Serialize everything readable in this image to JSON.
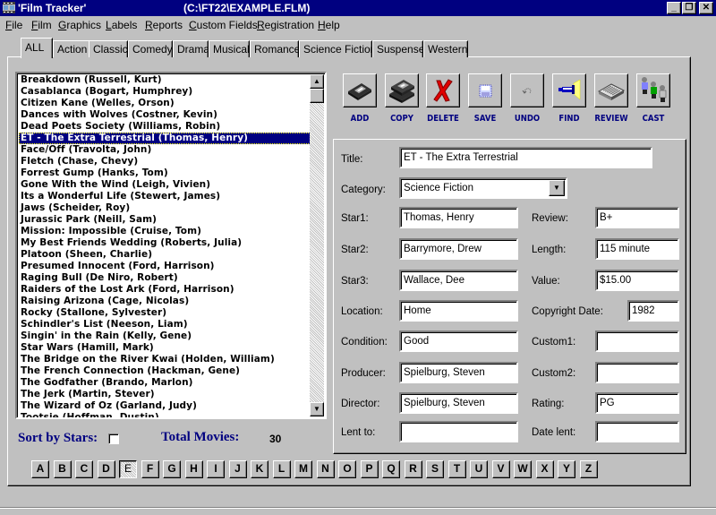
{
  "window": {
    "title": "'Film Tracker'",
    "path": "(C:\\FT22\\EXAMPLE.FLM)",
    "icons": {
      "app": "film-strip-icon",
      "minimize": "minimize-icon",
      "restore": "restore-icon",
      "close": "close-icon"
    },
    "controls": {
      "minimize": "_",
      "restore": "❐",
      "close": "✕"
    }
  },
  "menu": [
    {
      "label": "File",
      "accel": "F",
      "rest": "ile"
    },
    {
      "label": "Film",
      "accel": "F",
      "rest": "ilm"
    },
    {
      "label": "Graphics",
      "accel": "G",
      "rest": "raphics"
    },
    {
      "label": "Labels",
      "accel": "L",
      "rest": "abels"
    },
    {
      "label": "Reports",
      "accel": "R",
      "rest": "eports"
    },
    {
      "label": "Custom Fields",
      "accel": "C",
      "rest": "ustom Fields"
    },
    {
      "label": "Registration",
      "accel": "R",
      "rest": "egistration"
    },
    {
      "label": "Help",
      "accel": "H",
      "rest": "elp"
    }
  ],
  "tabs": [
    {
      "label": "ALL",
      "active": true
    },
    {
      "label": "Action"
    },
    {
      "label": "Classic"
    },
    {
      "label": "Comedy"
    },
    {
      "label": "Drama"
    },
    {
      "label": "Musical"
    },
    {
      "label": "Romance"
    },
    {
      "label": "Science Fiction"
    },
    {
      "label": "Suspense"
    },
    {
      "label": "Western"
    }
  ],
  "movies": [
    "Breakdown (Russell, Kurt)",
    "Casablanca (Bogart, Humphrey)",
    "Citizen Kane (Welles, Orson)",
    "Dances with Wolves (Costner, Kevin)",
    "Dead Poets Society (Williams, Robin)",
    "ET - The Extra Terrestrial (Thomas, Henry)",
    "Face/Off (Travolta, John)",
    "Fletch (Chase, Chevy)",
    "Forrest Gump (Hanks, Tom)",
    "Gone With the Wind (Leigh, Vivien)",
    "Its a Wonderful Life (Stewert, James)",
    "Jaws (Scheider, Roy)",
    "Jurassic Park (Neill, Sam)",
    "Mission: Impossible (Cruise, Tom)",
    "My Best Friends Wedding (Roberts, Julia)",
    "Platoon (Sheen, Charlie)",
    "Presumed Innocent (Ford, Harrison)",
    "Raging Bull (De Niro, Robert)",
    "Raiders of the Lost Ark (Ford, Harrison)",
    "Raising Arizona (Cage, Nicolas)",
    "Rocky (Stallone, Sylvester)",
    "Schindler's List (Neeson, Liam)",
    "Singin' in the Rain (Kelly, Gene)",
    "Star Wars (Hamill, Mark)",
    "The Bridge on the River Kwai (Holden, William)",
    "The French Connection (Hackman, Gene)",
    "The Godfather (Brando, Marlon)",
    "The Jerk (Martin, Stever)",
    "The Wizard of Oz (Garland, Judy)",
    "Tootsie (Hoffman, Dustin)"
  ],
  "selected_movie_index": 5,
  "scrollbar": {
    "up": "▲",
    "down": "▼"
  },
  "sort": {
    "label": "Sort by Stars:",
    "checked": false
  },
  "total": {
    "label": "Total Movies:",
    "value": "30"
  },
  "alphabet": [
    "A",
    "B",
    "C",
    "D",
    "E",
    "F",
    "G",
    "H",
    "I",
    "J",
    "K",
    "L",
    "M",
    "N",
    "O",
    "P",
    "Q",
    "R",
    "S",
    "T",
    "U",
    "V",
    "W",
    "X",
    "Y",
    "Z"
  ],
  "alphabet_selected": "E",
  "toolbar": [
    {
      "label": "ADD",
      "icon": "videotape-icon"
    },
    {
      "label": "COPY",
      "icon": "videotapes-copy-icon"
    },
    {
      "label": "DELETE",
      "icon": "red-x-icon"
    },
    {
      "label": "SAVE",
      "icon": "floppy-disk-icon"
    },
    {
      "label": "UNDO",
      "icon": "undo-arrow-icon"
    },
    {
      "label": "FIND",
      "icon": "flashlight-icon"
    },
    {
      "label": "REVIEW",
      "icon": "newspaper-icon"
    },
    {
      "label": "CAST",
      "icon": "people-icon"
    }
  ],
  "form": {
    "title": {
      "label": "Title:",
      "value": "ET - The Extra Terrestrial"
    },
    "category": {
      "label": "Category:",
      "value": "Science Fiction",
      "arrow": "▼"
    },
    "star1": {
      "label": "Star1:",
      "value": "Thomas, Henry"
    },
    "star2": {
      "label": "Star2:",
      "value": "Barrymore, Drew"
    },
    "star3": {
      "label": "Star3:",
      "value": "Wallace, Dee"
    },
    "location": {
      "label": "Location:",
      "value": "Home"
    },
    "condition": {
      "label": "Condition:",
      "value": "Good"
    },
    "producer": {
      "label": "Producer:",
      "value": "Spielburg, Steven"
    },
    "director": {
      "label": "Director:",
      "value": "Spielburg, Steven"
    },
    "lent_to": {
      "label": "Lent to:",
      "value": ""
    },
    "review": {
      "label": "Review:",
      "value": "B+"
    },
    "length": {
      "label": "Length:",
      "value": "115 minute"
    },
    "value": {
      "label": "Value:",
      "value": "$15.00"
    },
    "copyright": {
      "label": "Copyright Date:",
      "value": "1982"
    },
    "custom1": {
      "label": "Custom1:",
      "value": ""
    },
    "custom2": {
      "label": "Custom2:",
      "value": ""
    },
    "rating": {
      "label": "Rating:",
      "value": "PG"
    },
    "date_lent": {
      "label": "Date lent:",
      "value": ""
    }
  }
}
